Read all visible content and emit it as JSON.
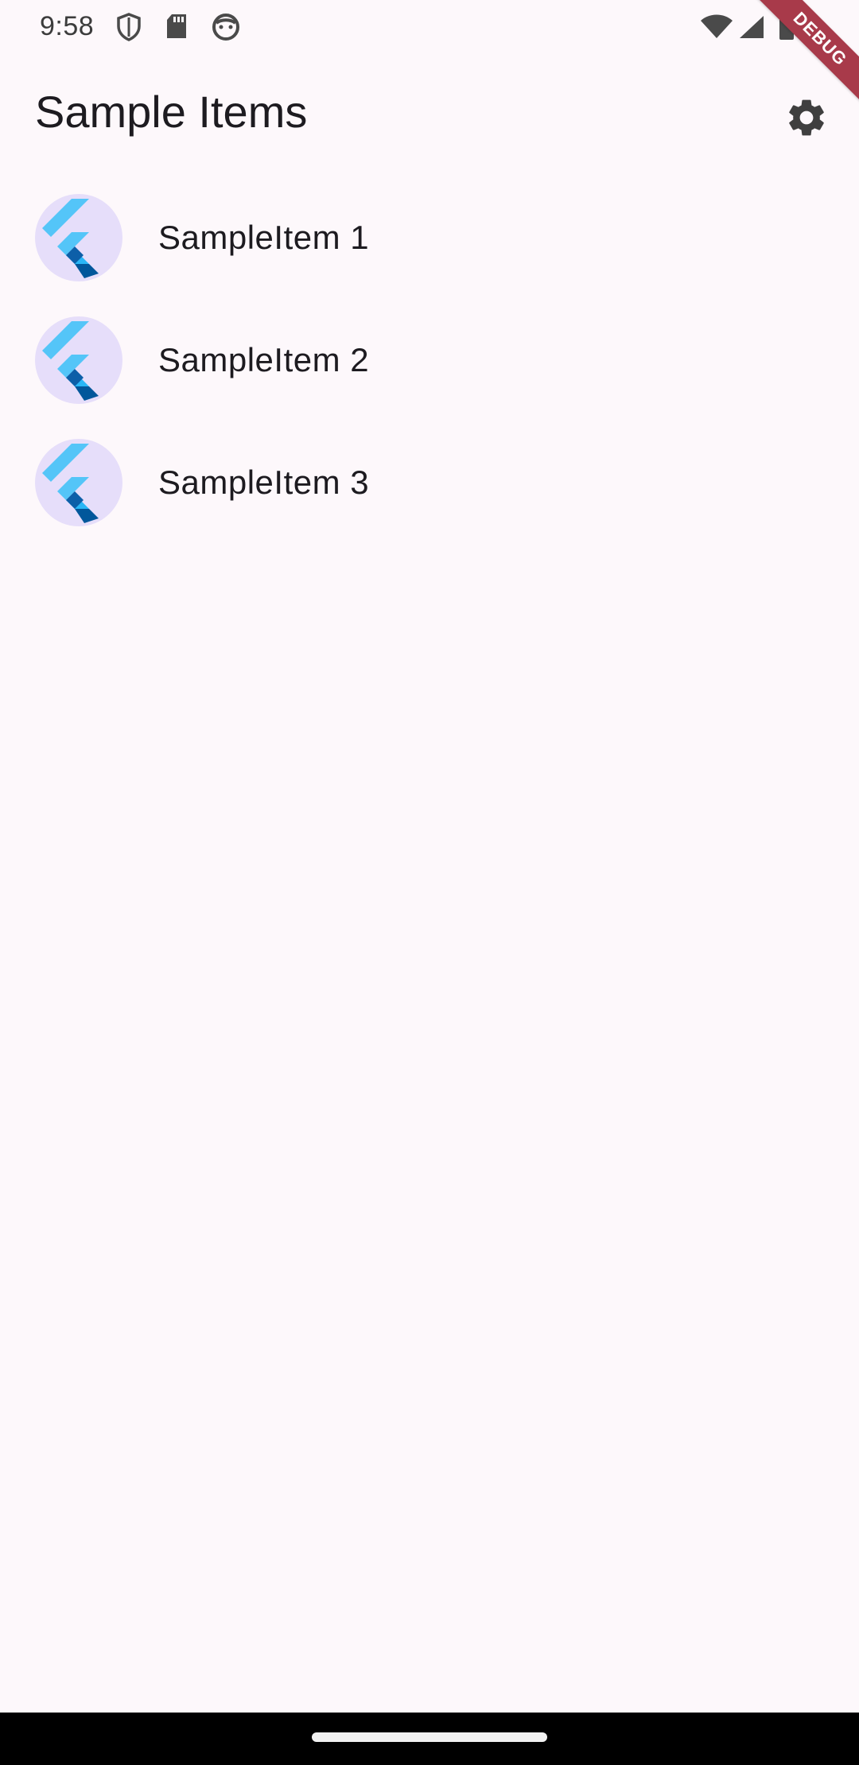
{
  "status_bar": {
    "time": "9:58",
    "icons": [
      "shield-icon",
      "sd-card-icon",
      "face-icon",
      "wifi-icon",
      "signal-icon",
      "battery-icon"
    ]
  },
  "debug_banner": {
    "label": "DEBUG",
    "color": "#a83a4a"
  },
  "app_bar": {
    "title": "Sample Items",
    "settings_icon": "gear-icon"
  },
  "list": {
    "items": [
      {
        "label": "SampleItem 1",
        "icon": "flutter-logo-icon"
      },
      {
        "label": "SampleItem 2",
        "icon": "flutter-logo-icon"
      },
      {
        "label": "SampleItem 3",
        "icon": "flutter-logo-icon"
      }
    ]
  },
  "colors": {
    "background": "#fdf8fb",
    "avatar_background": "#e6defa",
    "flutter_light": "#54c5f8",
    "flutter_mid": "#29b6f6",
    "flutter_dark": "#01579b"
  }
}
